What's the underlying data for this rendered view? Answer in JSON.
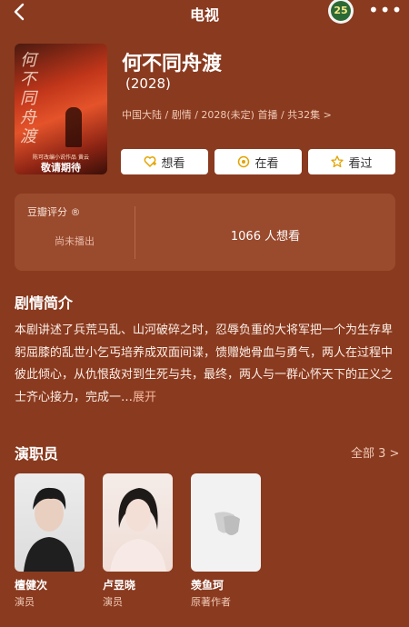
{
  "nav": {
    "title": "电视",
    "badge": "25",
    "more": "•••"
  },
  "poster": {
    "ink": "何不同舟渡",
    "subtitle": "陈可改编小说作品 黄云",
    "cta": "敬请期待"
  },
  "show": {
    "title": "何不同舟渡",
    "year": "(2028)",
    "meta": "中国大陆 / 剧情 / 2028(未定) 首播 / 共32集 >"
  },
  "actions": [
    {
      "label": "想看",
      "icon": "heart-plus-icon"
    },
    {
      "label": "在看",
      "icon": "target-icon"
    },
    {
      "label": "看过",
      "icon": "star-icon"
    }
  ],
  "rating": {
    "label": "豆瓣评分 ®",
    "status": "尚未播出",
    "want": "1066 人想看"
  },
  "synopsis": {
    "heading": "剧情简介",
    "text": "本剧讲述了兵荒马乱、山河破碎之时，忍辱负重的大将军把一个为生存卑躬屈膝的乱世小乞丐培养成双面间谍，馈赠她骨血与勇气，两人在过程中彼此倾心，从仇恨敌对到生死与共，最终，两人与一群心怀天下的正义之士齐心接力，完成一…",
    "expand": "展开"
  },
  "cast": {
    "heading": "演职员",
    "all": "全部 3 >",
    "members": [
      {
        "name": "檀健次",
        "role": "演员"
      },
      {
        "name": "卢昱晓",
        "role": "演员"
      },
      {
        "name": "羡鱼珂",
        "role": "原著作者"
      }
    ]
  },
  "colors": {
    "background": "#8a3a1f",
    "card": "#9a4a2d",
    "accent": "#e2a400"
  }
}
